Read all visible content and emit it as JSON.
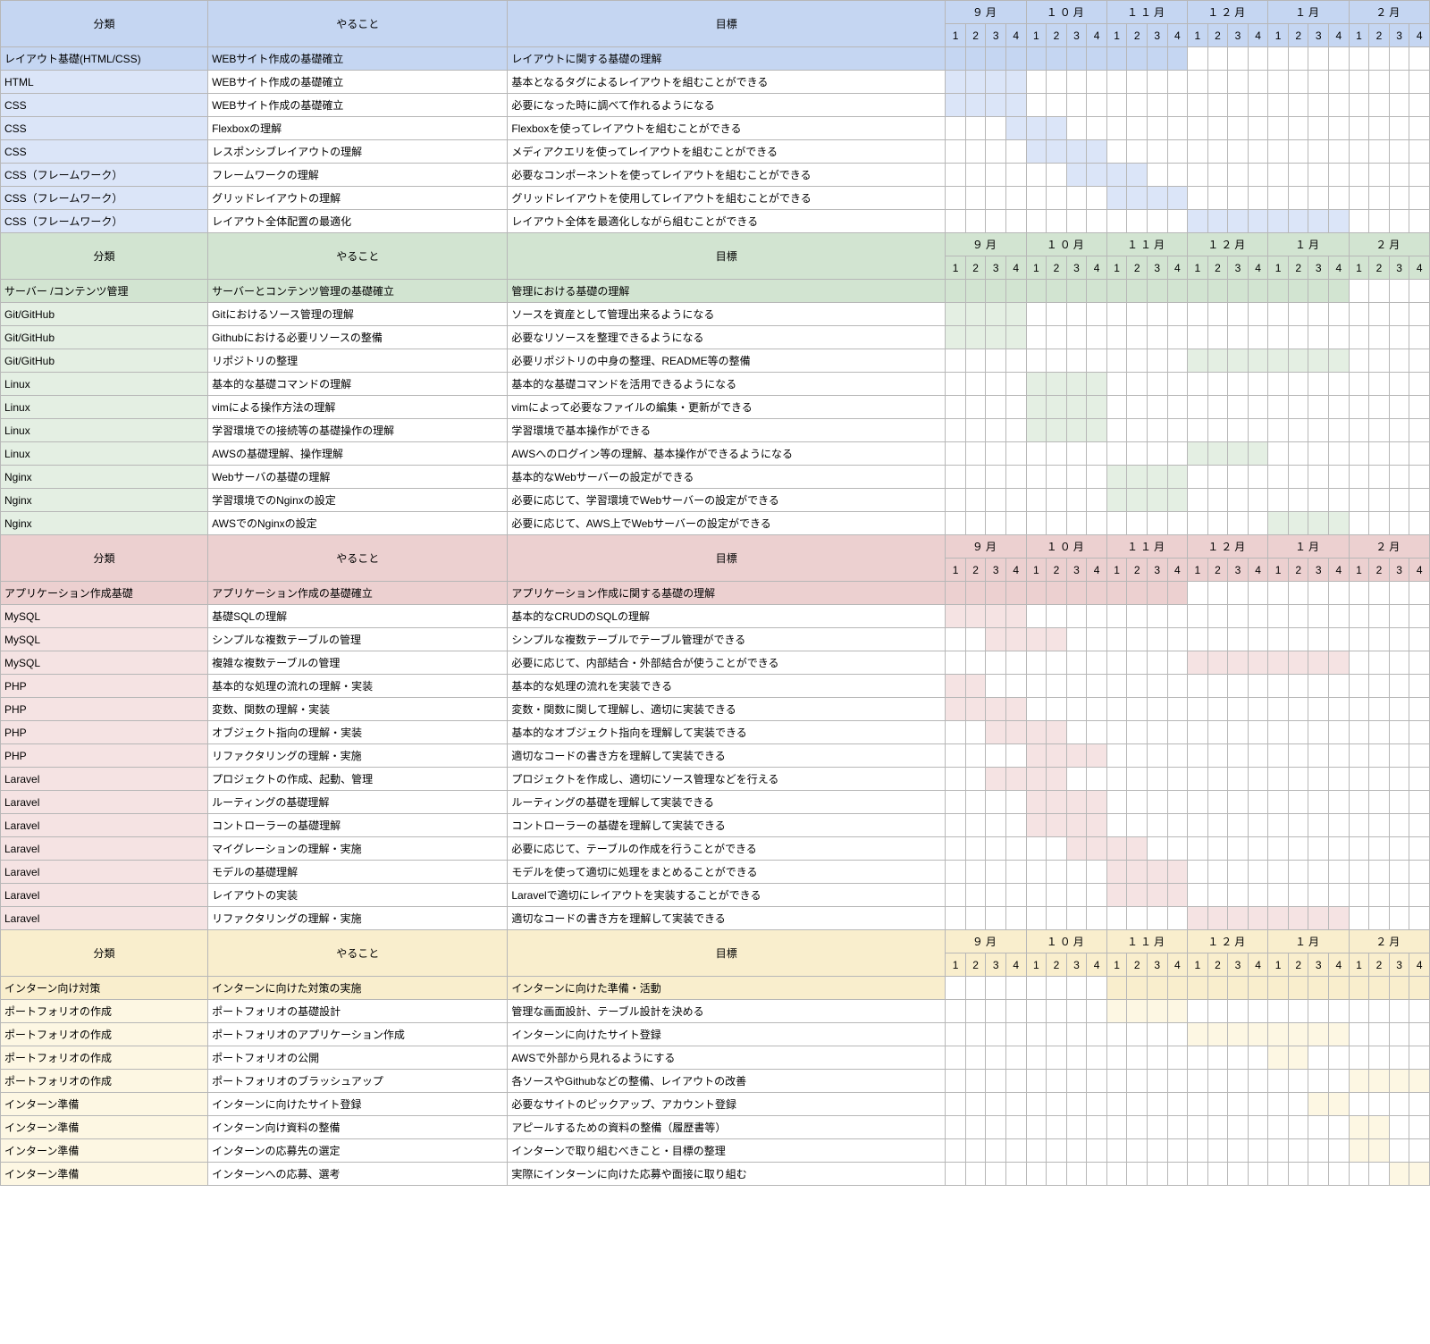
{
  "months": [
    "９月",
    "１０月",
    "１１月",
    "１２月",
    "１月",
    "２月"
  ],
  "weeks": [
    "1",
    "2",
    "3",
    "4"
  ],
  "headers": {
    "category": "分類",
    "task": "やること",
    "goal": "目標"
  },
  "sections": [
    {
      "color": "blue",
      "rows": [
        {
          "cat": "レイアウト基礎(HTML/CSS)",
          "task": "WEBサイト作成の基礎確立",
          "goal": "レイアウトに関する基礎の理解",
          "fill": [
            0,
            1,
            2,
            3,
            4,
            5,
            6,
            7,
            8,
            9,
            10,
            11
          ],
          "summary": true
        },
        {
          "cat": "HTML",
          "task": "WEBサイト作成の基礎確立",
          "goal": "基本となるタグによるレイアウトを組むことができる",
          "fill": [
            0,
            1,
            2,
            3
          ]
        },
        {
          "cat": "CSS",
          "task": "WEBサイト作成の基礎確立",
          "goal": "必要になった時に調べて作れるようになる",
          "fill": [
            0,
            1,
            2,
            3
          ]
        },
        {
          "cat": "CSS",
          "task": "Flexboxの理解",
          "goal": "Flexboxを使ってレイアウトを組むことができる",
          "fill": [
            3,
            4,
            5
          ]
        },
        {
          "cat": "CSS",
          "task": "レスポンシブレイアウトの理解",
          "goal": "メディアクエリを使ってレイアウトを組むことができる",
          "fill": [
            4,
            5,
            6,
            7
          ]
        },
        {
          "cat": "CSS（フレームワーク）",
          "task": "フレームワークの理解",
          "goal": "必要なコンポーネントを使ってレイアウトを組むことができる",
          "fill": [
            6,
            7,
            8,
            9
          ]
        },
        {
          "cat": "CSS（フレームワーク）",
          "task": "グリッドレイアウトの理解",
          "goal": "グリッドレイアウトを使用してレイアウトを組むことができる",
          "fill": [
            8,
            9,
            10,
            11
          ]
        },
        {
          "cat": "CSS（フレームワーク）",
          "task": "レイアウト全体配置の最適化",
          "goal": "レイアウト全体を最適化しながら組むことができる",
          "fill": [
            12,
            13,
            14,
            15,
            16,
            17,
            18,
            19
          ]
        }
      ]
    },
    {
      "color": "green",
      "rows": [
        {
          "cat": "サーバー /コンテンツ管理",
          "task": "サーバーとコンテンツ管理の基礎確立",
          "goal": "管理における基礎の理解",
          "fill": [
            0,
            1,
            2,
            3,
            4,
            5,
            6,
            7,
            8,
            9,
            10,
            11,
            12,
            13,
            14,
            15,
            16,
            17,
            18,
            19
          ],
          "summary": true
        },
        {
          "cat": "Git/GitHub",
          "task": "Gitにおけるソース管理の理解",
          "goal": "ソースを資産として管理出来るようになる",
          "fill": [
            0,
            1,
            2,
            3
          ]
        },
        {
          "cat": "Git/GitHub",
          "task": "Githubにおける必要リソースの整備",
          "goal": "必要なリソースを整理できるようになる",
          "fill": [
            0,
            1,
            2,
            3
          ]
        },
        {
          "cat": "Git/GitHub",
          "task": "リポジトリの整理",
          "goal": "必要リポジトリの中身の整理、README等の整備",
          "fill": [
            12,
            13,
            14,
            15,
            16,
            17,
            18,
            19
          ]
        },
        {
          "cat": "Linux",
          "task": "基本的な基礎コマンドの理解",
          "goal": "基本的な基礎コマンドを活用できるようになる",
          "fill": [
            4,
            5,
            6,
            7
          ]
        },
        {
          "cat": "Linux",
          "task": "vimによる操作方法の理解",
          "goal": "vimによって必要なファイルの編集・更新ができる",
          "fill": [
            4,
            5,
            6,
            7
          ]
        },
        {
          "cat": "Linux",
          "task": "学習環境での接続等の基礎操作の理解",
          "goal": "学習環境で基本操作ができる",
          "fill": [
            4,
            5,
            6,
            7
          ]
        },
        {
          "cat": "Linux",
          "task": "AWSの基礎理解、操作理解",
          "goal": "AWSへのログイン等の理解、基本操作ができるようになる",
          "fill": [
            12,
            13,
            14,
            15
          ]
        },
        {
          "cat": "Nginx",
          "task": "Webサーバの基礎の理解",
          "goal": "基本的なWebサーバーの設定ができる",
          "fill": [
            8,
            9,
            10,
            11
          ]
        },
        {
          "cat": "Nginx",
          "task": "学習環境でのNginxの設定",
          "goal": "必要に応じて、学習環境でWebサーバーの設定ができる",
          "fill": [
            8,
            9,
            10,
            11
          ]
        },
        {
          "cat": "Nginx",
          "task": "AWSでのNginxの設定",
          "goal": "必要に応じて、AWS上でWebサーバーの設定ができる",
          "fill": [
            16,
            17,
            18,
            19
          ]
        }
      ]
    },
    {
      "color": "pink",
      "rows": [
        {
          "cat": "アプリケーション作成基礎",
          "task": "アプリケーション作成の基礎確立",
          "goal": "アプリケーション作成に関する基礎の理解",
          "fill": [
            0,
            1,
            2,
            3,
            4,
            5,
            6,
            7,
            8,
            9,
            10,
            11
          ],
          "summary": true
        },
        {
          "cat": "MySQL",
          "task": "基礎SQLの理解",
          "goal": "基本的なCRUDのSQLの理解",
          "fill": [
            0,
            1,
            2,
            3
          ]
        },
        {
          "cat": "MySQL",
          "task": "シンプルな複数テーブルの管理",
          "goal": "シンプルな複数テーブルでテーブル管理ができる",
          "fill": [
            2,
            3,
            4,
            5
          ]
        },
        {
          "cat": "MySQL",
          "task": "複雑な複数テーブルの管理",
          "goal": "必要に応じて、内部結合・外部結合が使うことができる",
          "fill": [
            12,
            13,
            14,
            15,
            16,
            17,
            18,
            19
          ]
        },
        {
          "cat": "PHP",
          "task": "基本的な処理の流れの理解・実装",
          "goal": "基本的な処理の流れを実装できる",
          "fill": [
            0,
            1
          ]
        },
        {
          "cat": "PHP",
          "task": "変数、関数の理解・実装",
          "goal": "変数・関数に関して理解し、適切に実装できる",
          "fill": [
            0,
            1,
            2,
            3
          ]
        },
        {
          "cat": "PHP",
          "task": "オブジェクト指向の理解・実装",
          "goal": "基本的なオブジェクト指向を理解して実装できる",
          "fill": [
            2,
            3,
            4,
            5
          ]
        },
        {
          "cat": "PHP",
          "task": "リファクタリングの理解・実施",
          "goal": "適切なコードの書き方を理解して実装できる",
          "fill": [
            4,
            5,
            6,
            7
          ]
        },
        {
          "cat": "Laravel",
          "task": "プロジェクトの作成、起動、管理",
          "goal": "プロジェクトを作成し、適切にソース管理などを行える",
          "fill": [
            2,
            3,
            4,
            5
          ]
        },
        {
          "cat": "Laravel",
          "task": "ルーティングの基礎理解",
          "goal": "ルーティングの基礎を理解して実装できる",
          "fill": [
            4,
            5,
            6,
            7
          ]
        },
        {
          "cat": "Laravel",
          "task": "コントローラーの基礎理解",
          "goal": "コントローラーの基礎を理解して実装できる",
          "fill": [
            4,
            5,
            6,
            7
          ]
        },
        {
          "cat": "Laravel",
          "task": "マイグレーションの理解・実施",
          "goal": "必要に応じて、テーブルの作成を行うことができる",
          "fill": [
            6,
            7,
            8,
            9
          ]
        },
        {
          "cat": "Laravel",
          "task": "モデルの基礎理解",
          "goal": "モデルを使って適切に処理をまとめることができる",
          "fill": [
            8,
            9,
            10,
            11
          ]
        },
        {
          "cat": "Laravel",
          "task": "レイアウトの実装",
          "goal": "Laravelで適切にレイアウトを実装することができる",
          "fill": [
            8,
            9,
            10,
            11
          ]
        },
        {
          "cat": "Laravel",
          "task": "リファクタリングの理解・実施",
          "goal": "適切なコードの書き方を理解して実装できる",
          "fill": [
            12,
            13,
            14,
            15,
            16,
            17,
            18,
            19
          ]
        }
      ]
    },
    {
      "color": "yellow",
      "rows": [
        {
          "cat": "インターン向け対策",
          "task": "インターンに向けた対策の実施",
          "goal": "インターンに向けた準備・活動",
          "fill": [
            8,
            9,
            10,
            11,
            12,
            13,
            14,
            15,
            16,
            17,
            18,
            19,
            20,
            21,
            22,
            23
          ],
          "summary": true
        },
        {
          "cat": "ポートフォリオの作成",
          "task": "ポートフォリオの基礎設計",
          "goal": "管理な画面設計、テーブル設計を決める",
          "fill": [
            8,
            9,
            10,
            11
          ]
        },
        {
          "cat": "ポートフォリオの作成",
          "task": "ポートフォリオのアプリケーション作成",
          "goal": "インターンに向けたサイト登録",
          "fill": [
            12,
            13,
            14,
            15,
            16,
            17,
            18,
            19
          ]
        },
        {
          "cat": "ポートフォリオの作成",
          "task": "ポートフォリオの公開",
          "goal": "AWSで外部から見れるようにする",
          "fill": [
            16,
            17
          ]
        },
        {
          "cat": "ポートフォリオの作成",
          "task": "ポートフォリオのブラッシュアップ",
          "goal": "各ソースやGithubなどの整備、レイアウトの改善",
          "fill": [
            20,
            21,
            22,
            23
          ]
        },
        {
          "cat": "インターン準備",
          "task": "インターンに向けたサイト登録",
          "goal": "必要なサイトのピックアップ、アカウント登録",
          "fill": [
            18,
            19
          ]
        },
        {
          "cat": "インターン準備",
          "task": "インターン向け資料の整備",
          "goal": "アピールするための資料の整備（履歴書等）",
          "fill": [
            20,
            21
          ]
        },
        {
          "cat": "インターン準備",
          "task": "インターンの応募先の選定",
          "goal": "インターンで取り組むべきこと・目標の整理",
          "fill": [
            20,
            21
          ]
        },
        {
          "cat": "インターン準備",
          "task": "インターンへの応募、選考",
          "goal": "実際にインターンに向けた応募や面接に取り組む",
          "fill": [
            22,
            23
          ]
        }
      ]
    }
  ]
}
